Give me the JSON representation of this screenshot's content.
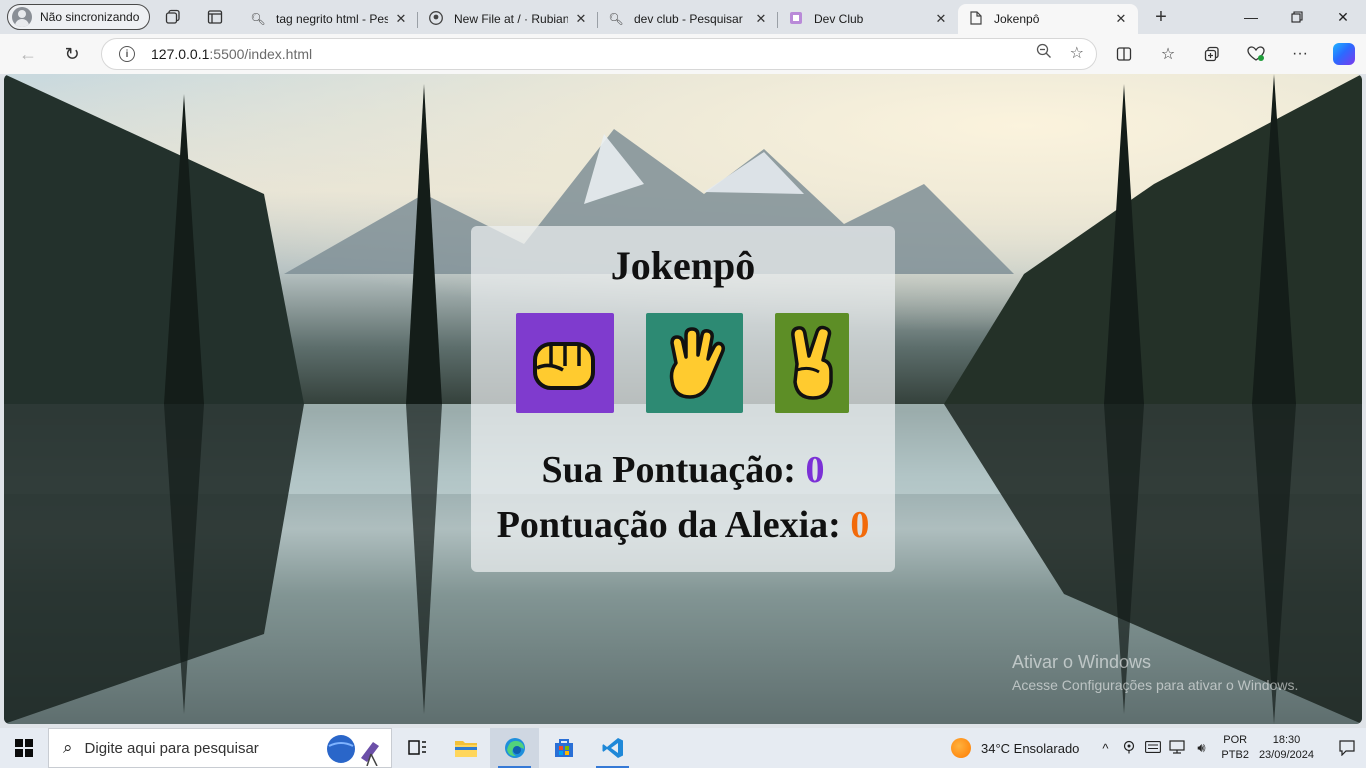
{
  "browser": {
    "profile_label": "Não sincronizando",
    "tabs": [
      {
        "title": "tag negrito html - Pesquisar",
        "icon": "search-icon"
      },
      {
        "title": "New File at / · Rubiano",
        "icon": "github-icon"
      },
      {
        "title": "dev club - Pesquisar",
        "icon": "search-icon"
      },
      {
        "title": "Dev Club",
        "icon": "devclub-icon"
      },
      {
        "title": "Jokenpô",
        "icon": "page-icon",
        "active": true
      }
    ],
    "url_host": "127.0.0.1",
    "url_path": ":5500/index.html"
  },
  "page": {
    "title": "Jokenpô",
    "choices": [
      {
        "name": "rock",
        "emoji": "👊",
        "color": "#7f3bce"
      },
      {
        "name": "paper",
        "emoji": "🖐",
        "color": "#2d8a73"
      },
      {
        "name": "scissors",
        "emoji": "✌",
        "color": "#5d8e26"
      }
    ],
    "user_score_label": "Sua Pontuação:",
    "user_score": "0",
    "cpu_score_label": "Pontuação da Alexia:",
    "cpu_score": "0",
    "colors": {
      "user_score": "#7b30d6",
      "cpu_score": "#f26a0a"
    }
  },
  "watermark": {
    "line1": "Ativar o Windows",
    "line2": "Acesse Configurações para ativar o Windows."
  },
  "taskbar": {
    "search_placeholder": "Digite aqui para pesquisar",
    "weather": "34°C  Ensolarado",
    "lang_line1": "POR",
    "lang_line2": "PTB2",
    "time": "18:30",
    "date": "23/09/2024"
  }
}
